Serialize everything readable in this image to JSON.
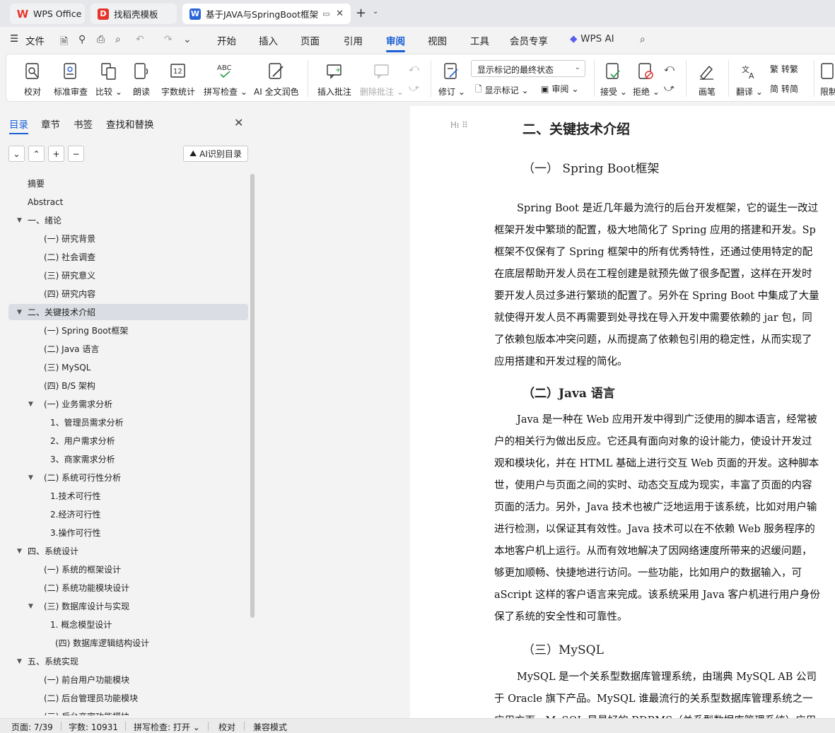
{
  "tabs": [
    {
      "label": "WPS Office",
      "icon": "wps-icon"
    },
    {
      "label": "找稻壳模板",
      "icon": "docer-icon"
    },
    {
      "label": "基于JAVA与SpringBoot框架",
      "icon": "word-doc-icon"
    }
  ],
  "menu": {
    "file": "文件",
    "items": [
      "开始",
      "插入",
      "页面",
      "引用",
      "审阅",
      "视图",
      "工具",
      "会员专享"
    ],
    "active": "审阅",
    "wps_ai": "WPS AI"
  },
  "ribbon": {
    "proofread": "校对",
    "standard_review": "标准审查",
    "compare": "比较",
    "read_aloud": "朗读",
    "word_count": "字数统计",
    "spell_check": "拼写检查",
    "ai_polish": "AI 全文润色",
    "insert_comment": "插入批注",
    "delete_comment": "删除批注",
    "track_changes": "修订",
    "display_mode": "显示标记的最终状态",
    "show_markup": "显示标记",
    "review": "审阅",
    "accept": "接受",
    "reject": "拒绝",
    "pen": "画笔",
    "translate": "翻译",
    "to_traditional": "转繁",
    "to_simplified": "转简",
    "restrict": "限制"
  },
  "sidebar": {
    "tabs": [
      "目录",
      "章节",
      "书签",
      "查找和替换"
    ],
    "active_tab": "目录",
    "ai_toc": "AI识别目录",
    "toc": [
      {
        "label": "摘要",
        "level": 0,
        "arrow": false
      },
      {
        "label": "Abstract",
        "level": 0,
        "arrow": false
      },
      {
        "label": "一、绪论",
        "level": 0,
        "arrow": true
      },
      {
        "label": "(一) 研究背景",
        "level": 1,
        "arrow": false
      },
      {
        "label": "(二) 社会调查",
        "level": 1,
        "arrow": false
      },
      {
        "label": "(三) 研究意义",
        "level": 1,
        "arrow": false
      },
      {
        "label": "(四) 研究内容",
        "level": 1,
        "arrow": false
      },
      {
        "label": "二、关键技术介绍",
        "level": 0,
        "arrow": true,
        "selected": true
      },
      {
        "label": "(一)    Spring Boot框架",
        "level": 1,
        "arrow": false
      },
      {
        "label": "(二) Java 语言",
        "level": 1,
        "arrow": false
      },
      {
        "label": "(三) MySQL",
        "level": 1,
        "arrow": false
      },
      {
        "label": "(四) B/S 架构",
        "level": 1,
        "arrow": false
      },
      {
        "label": "(一) 业务需求分析",
        "level": 1,
        "arrow": true
      },
      {
        "label": "1、管理员需求分析",
        "level": 2,
        "arrow": false
      },
      {
        "label": "2、用户需求分析",
        "level": 2,
        "arrow": false
      },
      {
        "label": "3、商家需求分析",
        "level": 2,
        "arrow": false
      },
      {
        "label": "(二) 系统可行性分析",
        "level": 1,
        "arrow": true
      },
      {
        "label": "1.技术可行性",
        "level": 2,
        "arrow": false
      },
      {
        "label": "2.经济可行性",
        "level": 2,
        "arrow": false
      },
      {
        "label": "3.操作可行性",
        "level": 2,
        "arrow": false
      },
      {
        "label": "四、系统设计",
        "level": 0,
        "arrow": true
      },
      {
        "label": "(一) 系统的框架设计",
        "level": 1,
        "arrow": false
      },
      {
        "label": "(二) 系统功能模块设计",
        "level": 1,
        "arrow": false
      },
      {
        "label": "(三)   数据库设计与实现",
        "level": 1,
        "arrow": true
      },
      {
        "label": "1. 概念模型设计",
        "level": 2,
        "arrow": false
      },
      {
        "label": "(四) 数据库逻辑结构设计",
        "level": 3,
        "arrow": false
      },
      {
        "label": "五、系统实现",
        "level": 0,
        "arrow": true
      },
      {
        "label": "(一) 前台用户功能模块",
        "level": 1,
        "arrow": false
      },
      {
        "label": "(二) 后台管理员功能模块",
        "level": 1,
        "arrow": false
      },
      {
        "label": "(三) 后台商家功能模块",
        "level": 1,
        "arrow": false
      }
    ]
  },
  "document": {
    "h1": "二、关键技术介绍",
    "h2_spring": "（一）    Spring Boot框架",
    "p_spring": [
      "Spring Boot 是近几年最为流行的后台开发框架，它的诞生一改过",
      "框架开发中繁琐的配置，极大地简化了 Spring 应用的搭建和开发。Sp",
      "框架不仅保有了 Spring 框架中的所有优秀特性，还通过使用特定的配",
      "在底层帮助开发人员在工程创建是就预先做了很多配置，这样在开发时",
      "要开发人员过多进行繁琐的配置了。另外在 Spring Boot 中集成了大量",
      "就使得开发人员不再需要到处寻找在导入开发中需要依赖的 jar 包，同",
      "了依赖包版本冲突问题，从而提高了依赖包引用的稳定性，从而实现了",
      "应用搭建和开发过程的简化。"
    ],
    "h2_java": "（二）Java 语言",
    "p_java": [
      "Java 是一种在 Web 应用开发中得到广泛使用的脚本语言，经常被",
      "户的相关行为做出反应。它还具有面向对象的设计能力，使设计开发过",
      "观和模块化，并在 HTML 基础上进行交互 Web 页面的开发。这种脚本",
      "世，使用户与页面之间的实时、动态交互成为现实，丰富了页面的内容",
      "页面的活力。另外，Java 技术也被广泛地运用于该系统，比如对用户输",
      "进行检测，以保证其有效性。Java 技术可以在不依赖 Web 服务程序的",
      "本地客户机上运行。从而有效地解决了因网络速度所带来的迟缓问题，",
      "够更加顺畅、快捷地进行访问。一些功能，比如用户的数据输入，可",
      "aScript 这样的客户语言来完成。该系统采用 Java 客户机进行用户身份",
      "保了系统的安全性和可靠性。"
    ],
    "h2_mysql": "（三）MySQL",
    "p_mysql": [
      "MySQL 是一个关系型数据库管理系统，由瑞典 MySQL  AB 公司",
      "于 Oracle 旗下产品。MySQL 谁最流行的关系型数据库管理系统之一",
      "应用方面，MySQL 是最好的 RDBMS（关系型数据库管理系统）应用"
    ]
  },
  "status": {
    "page": "页面: 7/39",
    "words": "字数: 10931",
    "spell": "拼写检查: 打开",
    "proof": "校对",
    "compat": "兼容模式"
  },
  "colors": {
    "accent": "#1a5fd6",
    "wps_red": "#e4352b"
  }
}
